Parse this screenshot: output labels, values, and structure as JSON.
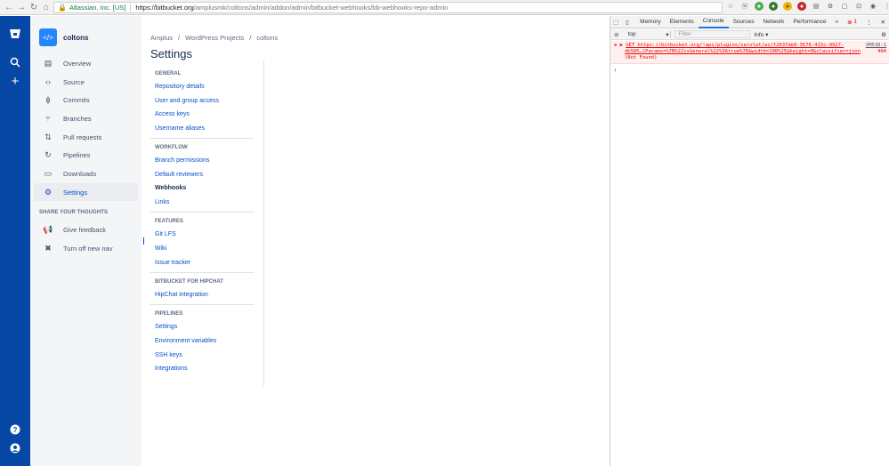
{
  "browser": {
    "security_label": "Atlassian, Inc. [US]",
    "url_host": "https://bitbucket.org",
    "url_path": "/amplusmk/coltons/admin/addon/admin/bitbucket-webhooks/bb-webhooks-repo-admin"
  },
  "repo": {
    "name": "coltons",
    "avatar_glyph": "</>"
  },
  "sidebar": {
    "items": [
      {
        "label": "Overview",
        "icon": "overview-icon"
      },
      {
        "label": "Source",
        "icon": "source-icon"
      },
      {
        "label": "Commits",
        "icon": "commits-icon"
      },
      {
        "label": "Branches",
        "icon": "branches-icon"
      },
      {
        "label": "Pull requests",
        "icon": "pull-requests-icon"
      },
      {
        "label": "Pipelines",
        "icon": "pipelines-icon"
      },
      {
        "label": "Downloads",
        "icon": "downloads-icon"
      },
      {
        "label": "Settings",
        "icon": "settings-icon"
      }
    ],
    "share_heading": "SHARE YOUR THOUGHTS",
    "feedback_label": "Give feedback",
    "turnoff_label": "Turn off new nav"
  },
  "breadcrumb": {
    "a": "Amplus",
    "b": "WordPress Projects",
    "c": "coltons"
  },
  "page_title": "Settings",
  "settings_nav": {
    "general": "GENERAL",
    "repo_details": "Repository details",
    "user_group": "User and group access",
    "access_keys": "Access keys",
    "username_aliases": "Username aliases",
    "workflow": "WORKFLOW",
    "branch_permissions": "Branch permissions",
    "default_reviewers": "Default reviewers",
    "webhooks": "Webhooks",
    "links": "Links",
    "features": "FEATURES",
    "git_lfs": "Git LFS",
    "wiki": "Wiki",
    "issue_tracker": "Issue tracker",
    "hipchat_head": "BITBUCKET FOR HIPCHAT",
    "hipchat_integration": "HipChat integration",
    "pipelines": "PIPELINES",
    "pl_settings": "Settings",
    "env_vars": "Environment variables",
    "ssh_keys": "SSH keys",
    "integrations": "Integrations"
  },
  "devtools": {
    "tabs": [
      "Memory",
      "Elements",
      "Console",
      "Sources",
      "Network",
      "Performance"
    ],
    "more": "»",
    "error_count": "1",
    "context": "top",
    "filter_placeholder": "Filter",
    "level": "Info",
    "error_line1": "GET https://bitbucket.org/!api/plugins/servlet/ac/f2637de0-3576-413c-9927-",
    "error_line2": "db585…lParams=%7B%22isGeneral%22%3Atrue%7D&width=100%25&height=0&classifier=json",
    "error_line3": "(Not Found)",
    "error_source": "VM538:1",
    "error_code": "404"
  }
}
